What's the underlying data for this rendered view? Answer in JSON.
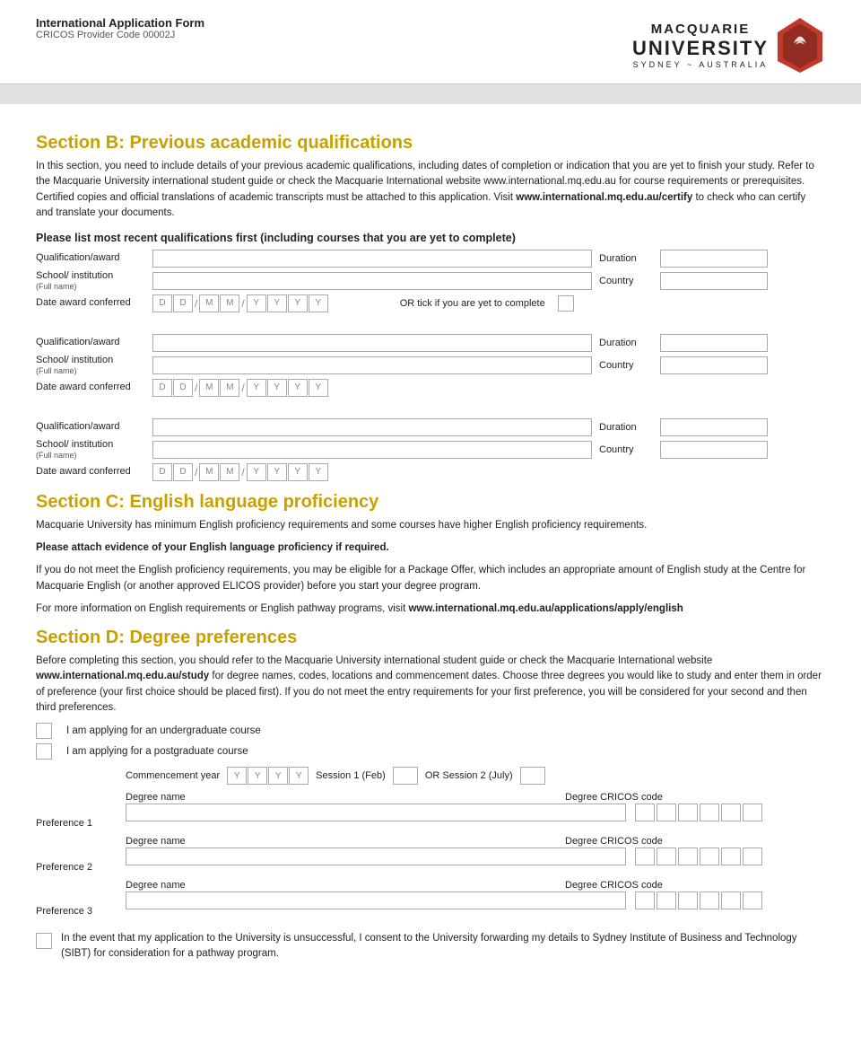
{
  "header": {
    "form_title": "International Application Form",
    "form_subtitle": "CRICOS Provider Code 00002J",
    "logo_macquarie": "MACQUARIE",
    "logo_university": "UNIVERSITY",
    "logo_sydney": "SYDNEY ~ AUSTRALIA"
  },
  "section_b": {
    "heading": "Section B: Previous academic qualifications",
    "body1": "In this section, you need to include details of your previous academic qualifications, including dates of completion or indication that you are yet to finish your study. Refer to the Macquarie University international student guide or check the Macquarie International website ",
    "body1_link": "www.international.mq.edu.au",
    "body1_cont": " for course requirements or prerequisites. Certified copies and official translations of academic transcripts must be attached to this application. Visit ",
    "body1_link2": "www.international.mq.edu.au/certify",
    "body1_cont2": " to check who can certify and translate your documents.",
    "sub_heading": "Please list most recent qualifications first (including courses that you are yet to complete)",
    "labels": {
      "qualification": "Qualification/award",
      "school": "School/ institution",
      "school_sub": "(Full name)",
      "date": "Date award conferred",
      "duration": "Duration",
      "country": "Country",
      "or_tick": "OR tick if you are yet to complete"
    },
    "date_placeholders": [
      "D",
      "D",
      "M",
      "M",
      "Y",
      "Y",
      "Y",
      "Y"
    ],
    "qualifications": [
      {
        "id": 1
      },
      {
        "id": 2
      },
      {
        "id": 3
      }
    ]
  },
  "section_c": {
    "heading": "Section C: English language proficiency",
    "body1": "Macquarie University has minimum English proficiency requirements and some courses have higher English proficiency requirements.",
    "body2": "Please attach evidence of your English language proficiency if required.",
    "body3": "If you do not meet the English proficiency requirements, you may be eligible for a Package Offer, which includes an appropriate amount of English study at the Centre for Macquarie English (or another approved ELICOS provider) before you start your degree program.",
    "body4": "For more information on English requirements or English pathway programs, visit ",
    "body4_link": "www.international.mq.edu.au/applications/apply/english"
  },
  "section_d": {
    "heading": "Section D: Degree preferences",
    "body1": "Before completing this section, you should refer to the Macquarie University international student guide or check the Macquarie International website ",
    "body1_link": "www.international.mq.edu.au/study",
    "body1_cont": " for degree names, codes, locations and commencement dates. Choose three degrees you would like to study and enter them in order of preference (your first choice should be placed first). If you do not meet the entry requirements for your first preference, you will be considered for your second and then third preferences.",
    "check1": "I am applying for an undergraduate course",
    "check2": "I am applying for a postgraduate course",
    "commencement_label": "Commencement year",
    "session1_label": "Session 1 (Feb)",
    "or_session": "OR Session 2 (July)",
    "degree_name_label": "Degree name",
    "degree_cricos_label": "Degree CRICOS code",
    "preferences": [
      {
        "label": "Preference 1"
      },
      {
        "label": "Preference 2"
      },
      {
        "label": "Preference 3"
      }
    ],
    "consent_text": "In the event that my application to the University is unsuccessful, I consent to the University forwarding my details to Sydney Institute of Business and Technology (SIBT) for consideration for a pathway program."
  }
}
